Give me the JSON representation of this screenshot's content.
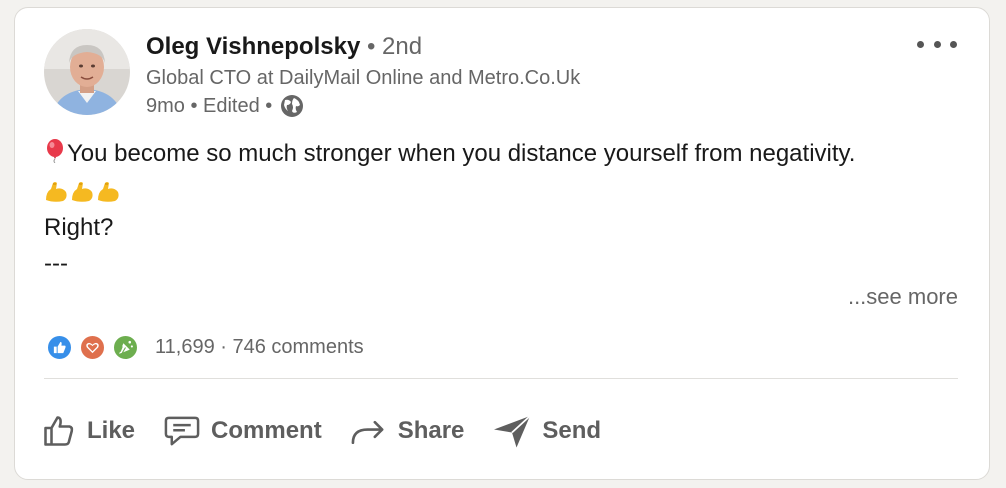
{
  "author": {
    "name": "Oleg Vishnepolsky",
    "degree": " • 2nd",
    "headline": "Global CTO at DailyMail Online and Metro.Co.Uk",
    "meta": "9mo • Edited • ",
    "visibility_icon": "globe-icon",
    "menu_icon": "more-options-icon"
  },
  "post": {
    "line1": "You become so much stronger when you distance yourself from negativity.",
    "emoji_prefix": "balloon-icon",
    "emoji_row": [
      "flexed-biceps-icon",
      "flexed-biceps-icon",
      "flexed-biceps-icon"
    ],
    "line3": "Right?",
    "line4": "---",
    "see_more": "...see more"
  },
  "social": {
    "reaction_icons": [
      "like-icon",
      "love-icon",
      "celebrate-icon"
    ],
    "summary": "11,699 · 746 comments"
  },
  "actions": {
    "like": "Like",
    "comment": "Comment",
    "share": "Share",
    "send": "Send"
  },
  "colors": {
    "like_blue": "#378fe9",
    "love_orange": "#df704d",
    "celebrate_green": "#6dae4f"
  }
}
